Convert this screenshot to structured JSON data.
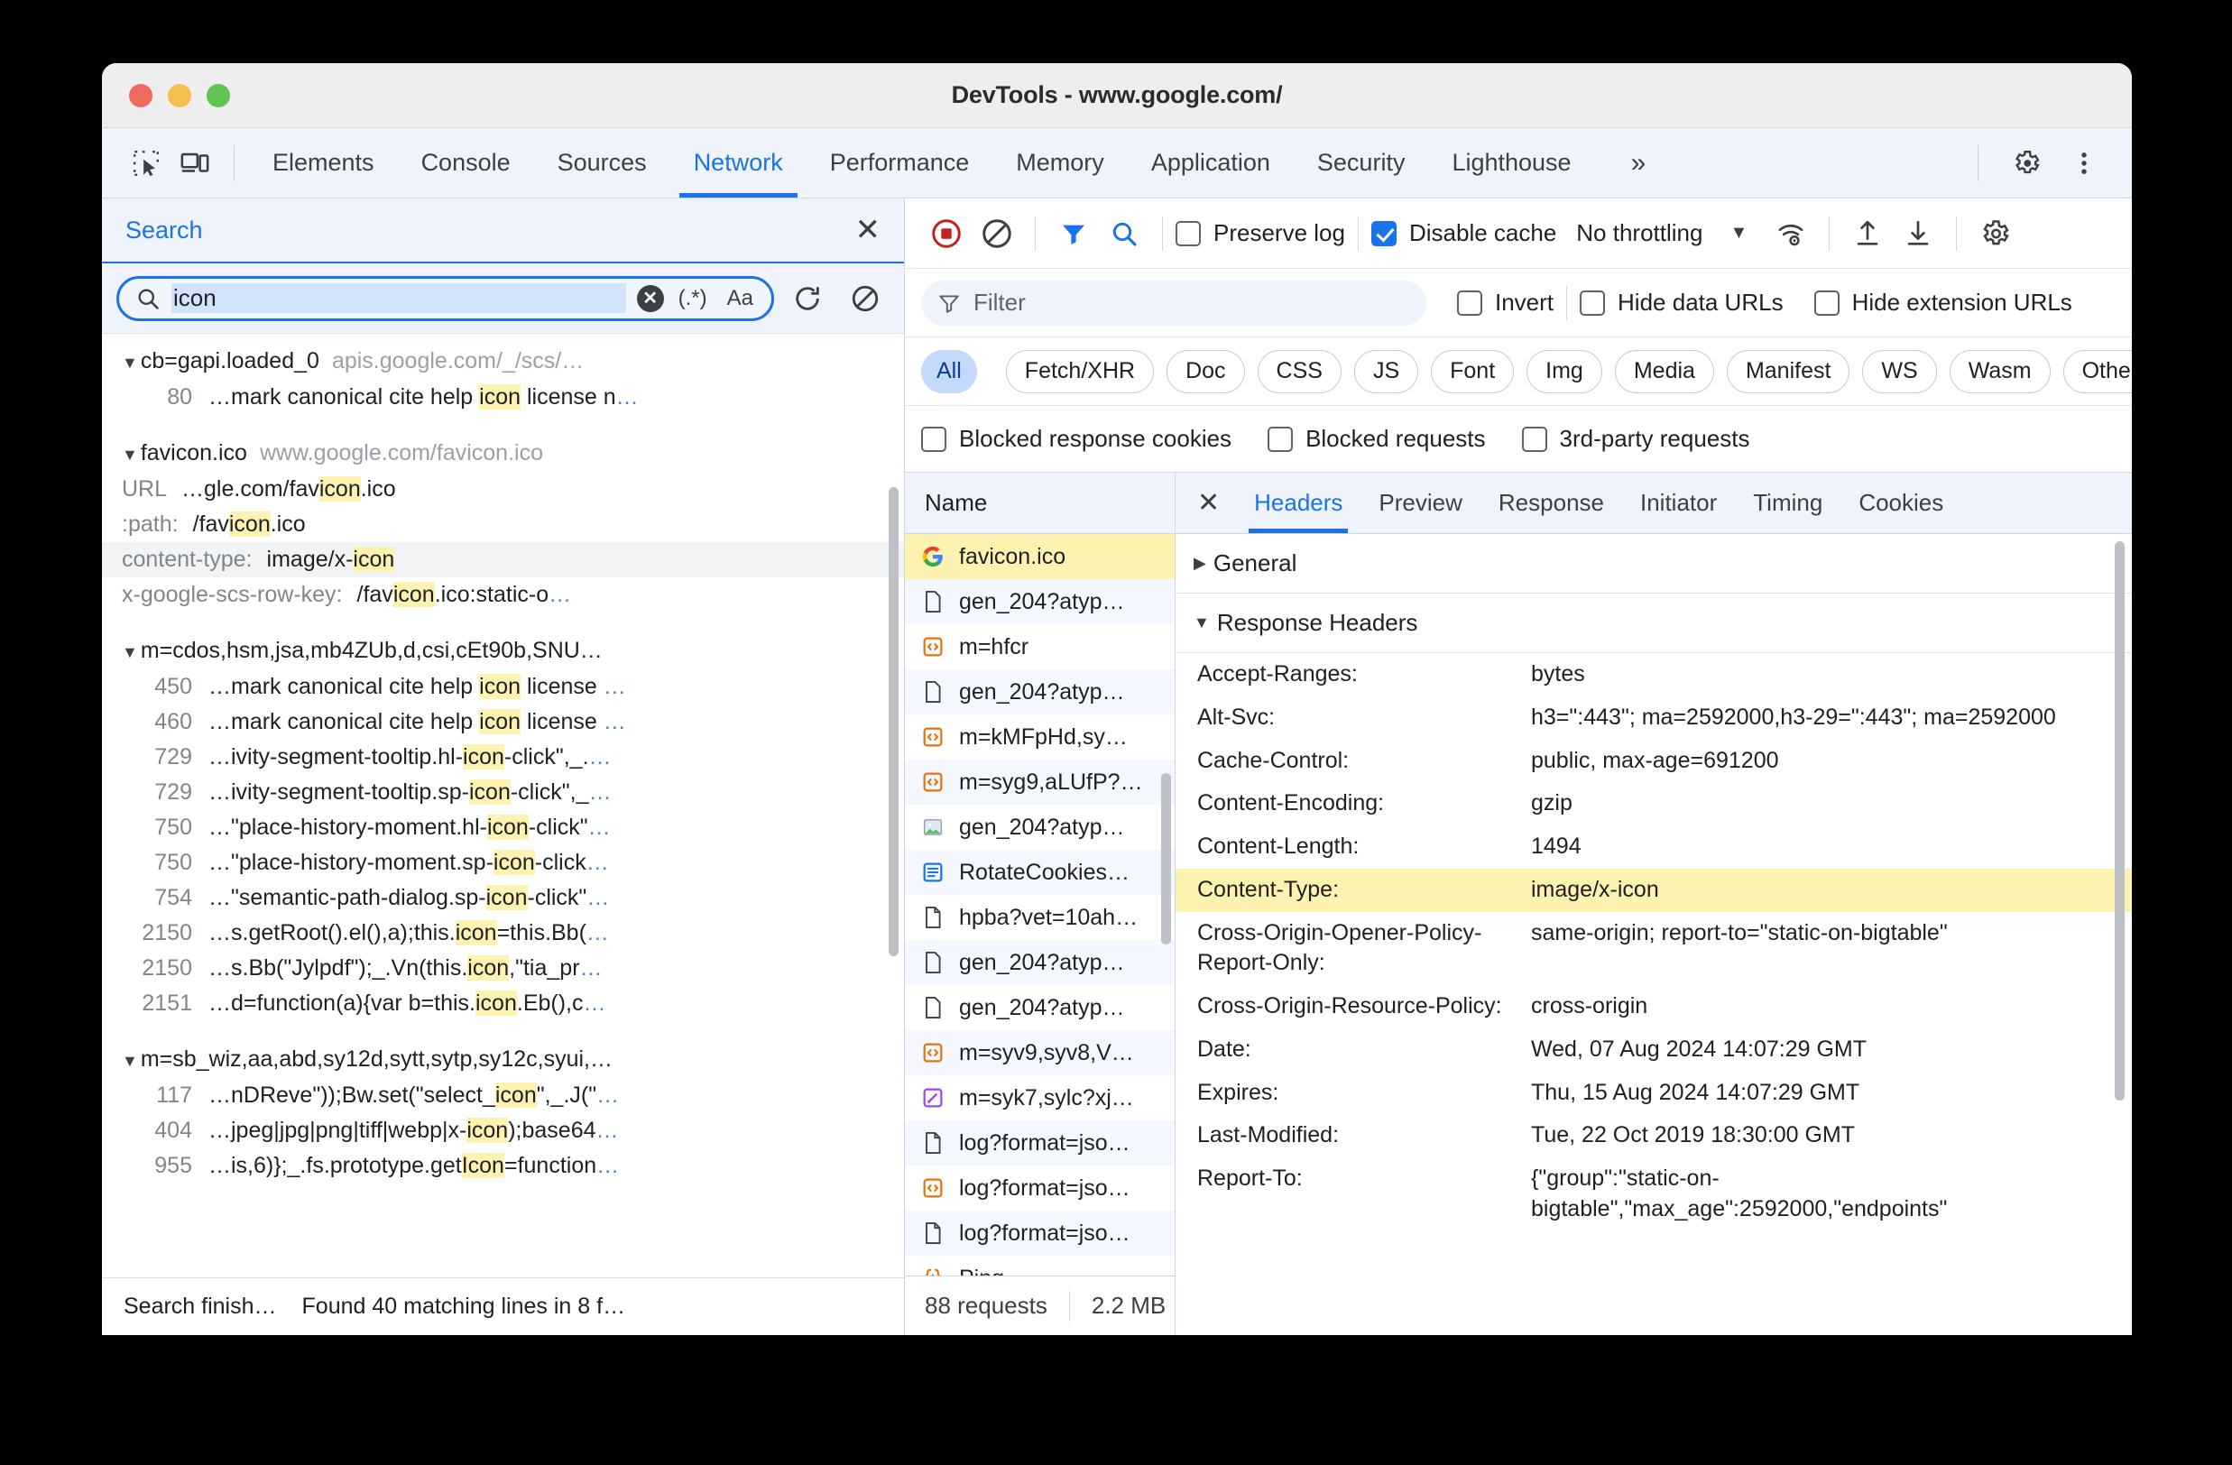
{
  "window": {
    "title": "DevTools - www.google.com/"
  },
  "devtools_tabs": {
    "inspect_icon": "inspect-element-icon",
    "device_icon": "device-toolbar-icon",
    "items": [
      {
        "label": "Elements",
        "active": false
      },
      {
        "label": "Console",
        "active": false
      },
      {
        "label": "Sources",
        "active": false
      },
      {
        "label": "Network",
        "active": true
      },
      {
        "label": "Performance",
        "active": false
      },
      {
        "label": "Memory",
        "active": false
      },
      {
        "label": "Application",
        "active": false
      },
      {
        "label": "Security",
        "active": false
      },
      {
        "label": "Lighthouse",
        "active": false
      }
    ],
    "more_label": "»",
    "settings_icon": "gear-icon",
    "menu_icon": "kebab-menu-icon"
  },
  "search_panel": {
    "title": "Search",
    "close_label": "✕",
    "query": "icon",
    "clear_label": "✕",
    "regex_label": "(.*)",
    "case_label": "Aa",
    "refresh_icon": "refresh-icon",
    "clear_icon": "clear-icon",
    "status": "Search finish…",
    "found": "Found 40 matching lines in 8 f…",
    "groups": [
      {
        "name": "cb=gapi.loaded_0",
        "url": "apis.google.com/_/scs/…",
        "lines": [
          {
            "ln": "80",
            "pre": "…mark canonical cite help ",
            "hit": "icon",
            "post": " license n",
            "ell": "…"
          }
        ]
      },
      {
        "name": "favicon.ico",
        "url": "www.google.com/favicon.ico",
        "kv": [
          {
            "key": "URL",
            "pre": "…gle.com/fav",
            "hit": "icon",
            "post": ".ico",
            "sel": false
          },
          {
            "key": ":path:",
            "pre": "/fav",
            "hit": "icon",
            "post": ".ico",
            "sel": false
          },
          {
            "key": "content-type:",
            "pre": "image/x-",
            "hit": "icon",
            "post": "",
            "sel": true
          },
          {
            "key": "x-google-scs-row-key:",
            "pre": "/fav",
            "hit": "icon",
            "post": ".ico:static-o",
            "ell": "…",
            "sel": false
          }
        ]
      },
      {
        "name": "m=cdos,hsm,jsa,mb4ZUb,d,csi,cEt90b,SNU…",
        "url": "",
        "lines": [
          {
            "ln": "450",
            "pre": "…mark canonical cite help ",
            "hit": "icon",
            "post": " license ",
            "ell": "…"
          },
          {
            "ln": "460",
            "pre": "…mark canonical cite help ",
            "hit": "icon",
            "post": " license ",
            "ell": "…"
          },
          {
            "ln": "729",
            "pre": "…ivity-segment-tooltip.hl-",
            "hit": "icon",
            "post": "-click\",_.",
            "ell": "…"
          },
          {
            "ln": "729",
            "pre": "…ivity-segment-tooltip.sp-",
            "hit": "icon",
            "post": "-click\",_",
            "ell": "…"
          },
          {
            "ln": "750",
            "pre": "…\"place-history-moment.hl-",
            "hit": "icon",
            "post": "-click\"",
            "ell": "…"
          },
          {
            "ln": "750",
            "pre": "…\"place-history-moment.sp-",
            "hit": "icon",
            "post": "-click",
            "ell": "…"
          },
          {
            "ln": "754",
            "pre": "…\"semantic-path-dialog.sp-",
            "hit": "icon",
            "post": "-click\"",
            "ell": "…"
          },
          {
            "ln": "2150",
            "pre": "…s.getRoot().el(),a);this.",
            "hit": "icon",
            "post": "=this.Bb(",
            "ell": "…"
          },
          {
            "ln": "2150",
            "pre": "…s.Bb(\"Jylpdf\");_.Vn(this.",
            "hit": "icon",
            "post": ",\"tia_pr",
            "ell": "…"
          },
          {
            "ln": "2151",
            "pre": "…d=function(a){var b=this.",
            "hit": "icon",
            "post": ".Eb(),c",
            "ell": "…"
          }
        ]
      },
      {
        "name": "m=sb_wiz,aa,abd,sy12d,sytt,sytp,sy12c,syui,…",
        "url": "",
        "lines": [
          {
            "ln": "117",
            "pre": "…nDReve\"));Bw.set(\"select_",
            "hit": "icon",
            "post": "\",_.J(\"",
            "ell": "…"
          },
          {
            "ln": "404",
            "pre": "…jpeg|jpg|png|tiff|webp|x-",
            "hit": "icon",
            "post": ");base64",
            "ell": "…"
          },
          {
            "ln": "955",
            "pre": "…is,6)};_.fs.prototype.get",
            "hit": "Icon",
            "post": "=function",
            "ell": "…"
          }
        ]
      }
    ]
  },
  "network": {
    "record_icon": "record-stop-icon",
    "clear_icon": "clear-network-icon",
    "filter_icon": "filter-funnel-icon",
    "search_icon": "search-icon",
    "preserve_log": {
      "label": "Preserve log",
      "checked": false
    },
    "disable_cache": {
      "label": "Disable cache",
      "checked": true
    },
    "throttling": "No throttling",
    "throttle_caret": "▼",
    "wifi_icon": "network-conditions-icon",
    "import_icon": "import-har-icon",
    "export_icon": "export-har-icon",
    "settings_icon": "network-settings-gear-icon",
    "filter_placeholder": "Filter",
    "invert": {
      "label": "Invert",
      "checked": false
    },
    "hide_data_urls": {
      "label": "Hide data URLs",
      "checked": false
    },
    "hide_extension_urls": {
      "label": "Hide extension URLs",
      "checked": false
    },
    "types": [
      "All",
      "Fetch/XHR",
      "Doc",
      "CSS",
      "JS",
      "Font",
      "Img",
      "Media",
      "Manifest",
      "WS",
      "Wasm",
      "Other"
    ],
    "active_type": "All",
    "cookie_filters": [
      {
        "label": "Blocked response cookies",
        "checked": false
      },
      {
        "label": "Blocked requests",
        "checked": false
      },
      {
        "label": "3rd-party requests",
        "checked": false
      }
    ],
    "list_header": "Name",
    "requests": [
      {
        "name": "Ping",
        "icon": "ping-json-icon",
        "selected": false
      },
      {
        "name": "log?format=jso…",
        "icon": "document-icon",
        "selected": false
      },
      {
        "name": "log?format=jso…",
        "icon": "script-icon",
        "selected": false
      },
      {
        "name": "log?format=jso…",
        "icon": "document-icon",
        "selected": false
      },
      {
        "name": "m=syk7,sylc?xj…",
        "icon": "stylesheet-icon",
        "selected": false
      },
      {
        "name": "m=syv9,syv8,V…",
        "icon": "script-icon",
        "selected": false
      },
      {
        "name": "gen_204?atyp…",
        "icon": "generic-file-icon",
        "selected": false
      },
      {
        "name": "gen_204?atyp…",
        "icon": "generic-file-icon",
        "selected": false
      },
      {
        "name": "hpba?vet=10ah…",
        "icon": "document-icon",
        "selected": false
      },
      {
        "name": "RotateCookies…",
        "icon": "fetch-xhr-icon",
        "selected": false
      },
      {
        "name": "gen_204?atyp…",
        "icon": "image-icon",
        "selected": false
      },
      {
        "name": "m=syg9,aLUfP?…",
        "icon": "script-icon",
        "selected": false
      },
      {
        "name": "m=kMFpHd,sy…",
        "icon": "script-icon",
        "selected": false
      },
      {
        "name": "gen_204?atyp…",
        "icon": "generic-file-icon",
        "selected": false
      },
      {
        "name": "m=hfcr",
        "icon": "script-icon",
        "selected": false
      },
      {
        "name": "gen_204?atyp…",
        "icon": "generic-file-icon",
        "selected": false
      },
      {
        "name": "favicon.ico",
        "icon": "google-favicon-icon",
        "selected": true
      }
    ],
    "footer": {
      "requests": "88 requests",
      "size": "2.2 MB"
    }
  },
  "detail": {
    "close_label": "✕",
    "tabs": [
      {
        "label": "Headers",
        "active": true
      },
      {
        "label": "Preview",
        "active": false
      },
      {
        "label": "Response",
        "active": false
      },
      {
        "label": "Initiator",
        "active": false
      },
      {
        "label": "Timing",
        "active": false
      },
      {
        "label": "Cookies",
        "active": false
      }
    ],
    "sections": [
      {
        "label": "General",
        "expanded": false,
        "tri": "▶"
      },
      {
        "label": "Response Headers",
        "expanded": true,
        "tri": "▼"
      }
    ],
    "headers": [
      {
        "name": "Accept-Ranges:",
        "value": "bytes",
        "highlight": false
      },
      {
        "name": "Alt-Svc:",
        "value": "h3=\":443\"; ma=2592000,h3-29=\":443\"; ma=2592000",
        "highlight": false
      },
      {
        "name": "Cache-Control:",
        "value": "public, max-age=691200",
        "highlight": false
      },
      {
        "name": "Content-Encoding:",
        "value": "gzip",
        "highlight": false
      },
      {
        "name": "Content-Length:",
        "value": "1494",
        "highlight": false
      },
      {
        "name": "Content-Type:",
        "value": "image/x-icon",
        "highlight": true
      },
      {
        "name": "Cross-Origin-Opener-Policy-Report-Only:",
        "value": "same-origin; report-to=\"static-on-bigtable\"",
        "highlight": false
      },
      {
        "name": "Cross-Origin-Resource-Policy:",
        "value": "cross-origin",
        "highlight": false
      },
      {
        "name": "Date:",
        "value": "Wed, 07 Aug 2024 14:07:29 GMT",
        "highlight": false
      },
      {
        "name": "Expires:",
        "value": "Thu, 15 Aug 2024 14:07:29 GMT",
        "highlight": false
      },
      {
        "name": "Last-Modified:",
        "value": "Tue, 22 Oct 2019 18:30:00 GMT",
        "highlight": false
      },
      {
        "name": "Report-To:",
        "value": "{\"group\":\"static-on-bigtable\",\"max_age\":2592000,\"endpoints\"",
        "highlight": false
      }
    ]
  },
  "colors": {
    "accent": "#1a73e8",
    "highlight": "#fdf2b0",
    "selection": "#d2e3fc"
  }
}
